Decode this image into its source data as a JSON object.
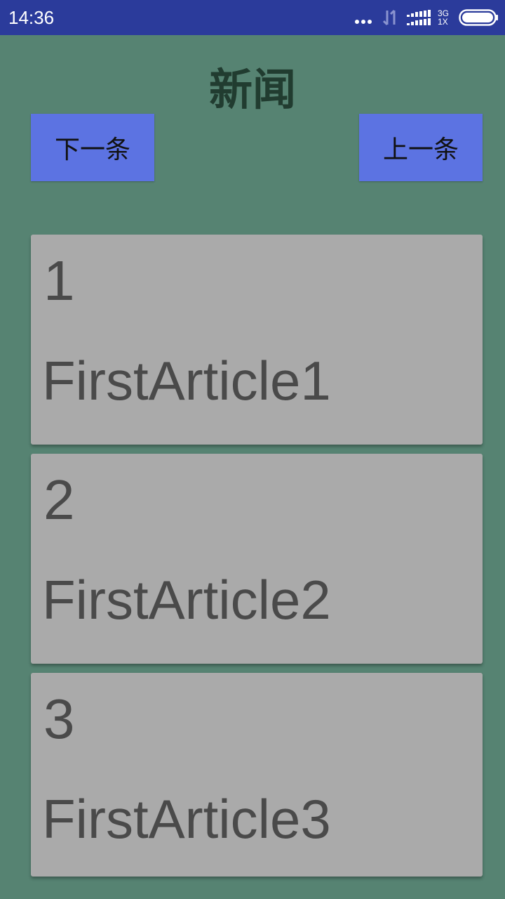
{
  "status_bar": {
    "time": "14:36",
    "network_top": "3G",
    "network_bottom": "1X"
  },
  "header": {
    "title": "新闻"
  },
  "buttons": {
    "next_label": "下一条",
    "prev_label": "上一条"
  },
  "articles": [
    {
      "number": "1",
      "title": "FirstArticle1"
    },
    {
      "number": "2",
      "title": "FirstArticle2"
    },
    {
      "number": "3",
      "title": "FirstArticle3"
    }
  ],
  "colors": {
    "background": "#568372",
    "status_bar": "#2b3b9b",
    "button": "#5c73e2",
    "card": "#aaaaaa",
    "title_text": "#213c30"
  }
}
